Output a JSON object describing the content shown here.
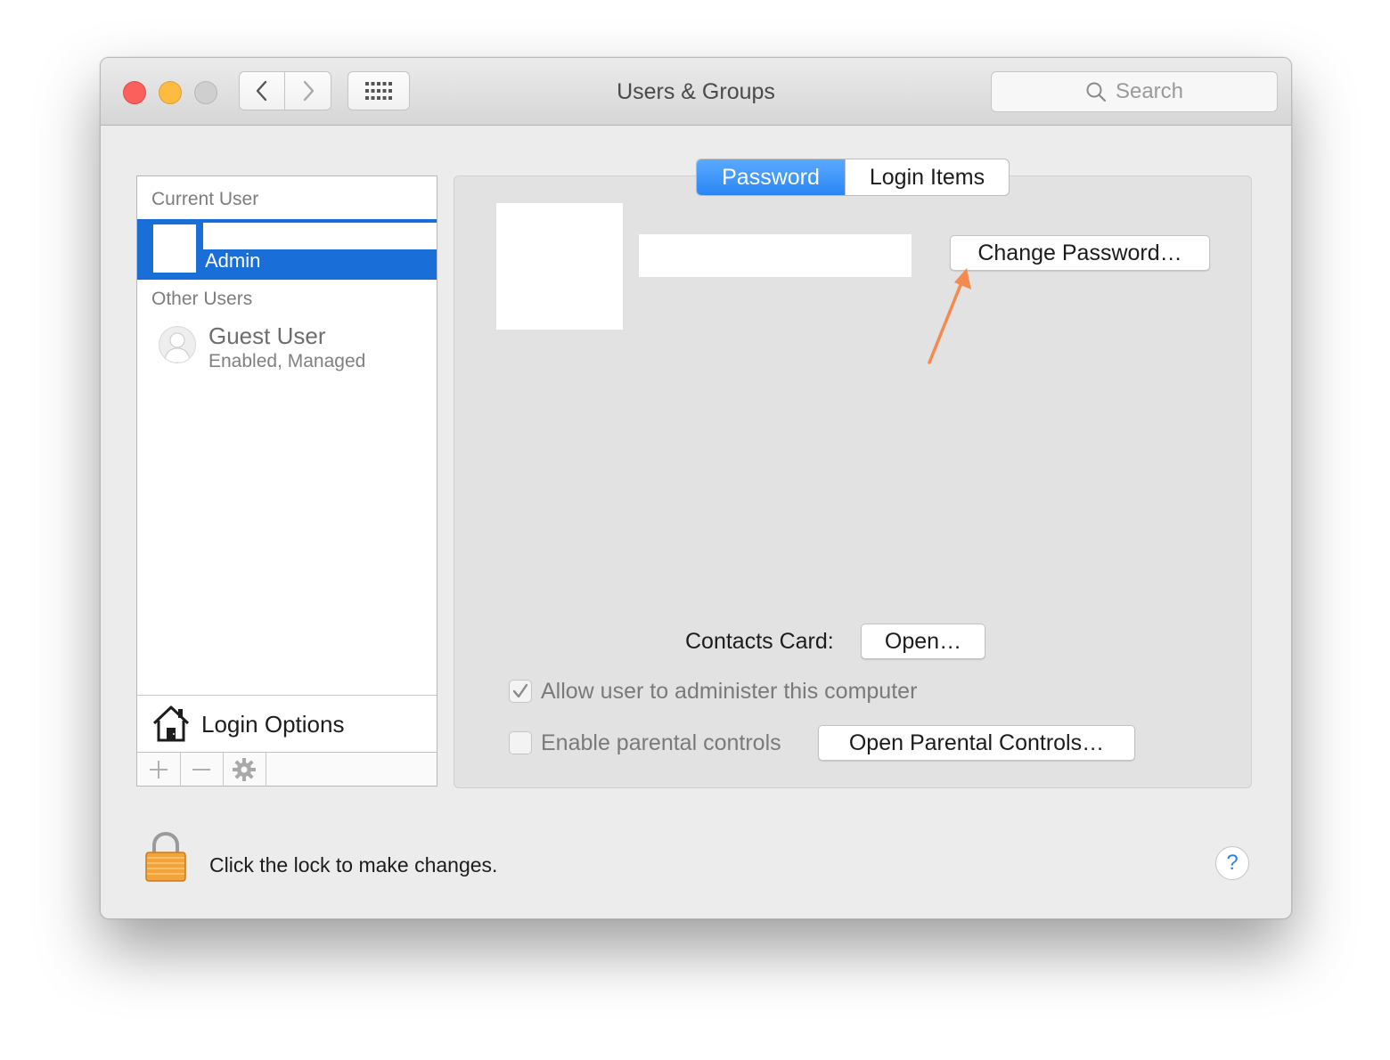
{
  "window": {
    "title": "Users & Groups"
  },
  "toolbar": {
    "search_placeholder": "Search"
  },
  "sidebar": {
    "current_user_label": "Current User",
    "current_user": {
      "role": "Admin"
    },
    "other_users_label": "Other Users",
    "guest": {
      "name": "Guest User",
      "status": "Enabled, Managed"
    },
    "login_options_label": "Login Options"
  },
  "tabs": [
    {
      "label": "Password",
      "active": true
    },
    {
      "label": "Login Items",
      "active": false
    }
  ],
  "main": {
    "change_password_label": "Change Password…",
    "contacts_card_label": "Contacts Card:",
    "open_label": "Open…",
    "allow_admin_label": "Allow user to administer this computer",
    "allow_admin_checked": true,
    "parental_controls_label": "Enable parental controls",
    "parental_controls_checked": false,
    "open_parental_label": "Open Parental Controls…"
  },
  "footer": {
    "lock_text": "Click the lock to make changes.",
    "help_glyph": "?"
  },
  "colors": {
    "accent": "#1a6ed8",
    "annotation_arrow": "#f58a4f",
    "close": "#fc605c",
    "minimize": "#fdbc40"
  },
  "icons": [
    "chevron-left-icon",
    "chevron-right-icon",
    "grid-icon",
    "search-icon",
    "user-icon",
    "home-icon",
    "plus-icon",
    "minus-icon",
    "gear-icon",
    "check-icon",
    "lock-icon",
    "help-icon"
  ]
}
